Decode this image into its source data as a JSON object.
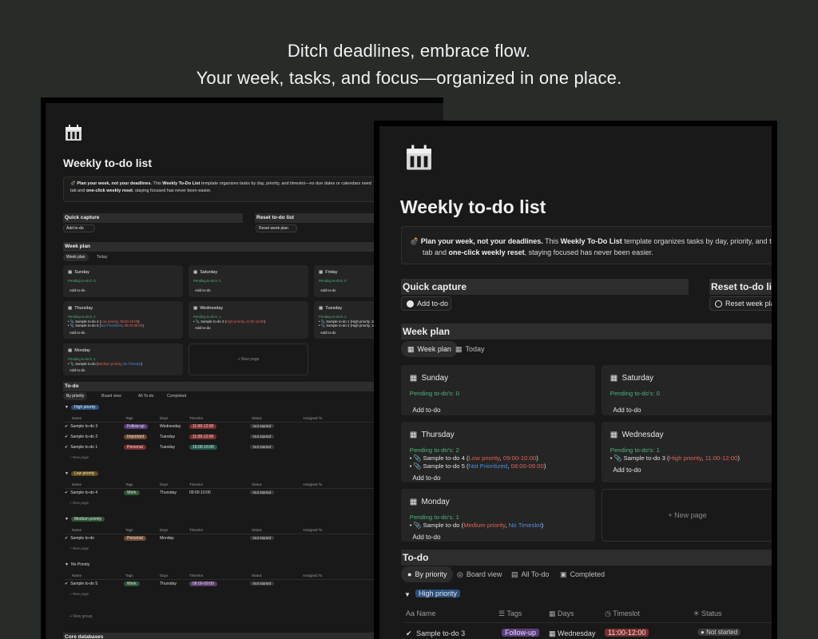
{
  "headline": {
    "line1": "Ditch deadlines, embrace flow.",
    "line2": "Your week, tasks, and focus—organized in one place."
  },
  "page": {
    "title": "Weekly to-do list",
    "callout": {
      "emoji": "💣",
      "bold1": "Plan your week, not your deadlines.",
      "t1": " This ",
      "bold2": "Weekly To-Do List",
      "t2_front": " template organizes tasks by day, priority, and ti",
      "t2_back": " template organizes tasks by day, priority, and timeslot—no due dates or calendars need",
      "line2_a": "tab and ",
      "line2_bold": "one-click weekly reset",
      "line2_b": ", staying focused has never been easier."
    },
    "quick_capture": "Quick capture",
    "add_todo": "Add to-do",
    "reset_front": "Reset to-do list",
    "reset_back": "Reset to-do list",
    "reset_week_front": "Reset week plan",
    "reset_week_back": "Reset week plan",
    "week_plan": "Week plan",
    "tab_week_plan": "Week plan",
    "tab_today": "Today",
    "new_page": "+ New page",
    "todo": "To-do",
    "tab_by_priority": "By priority",
    "tab_board_view": "Board view",
    "tab_all_todo": "All To-do",
    "tab_completed": "Completed",
    "core_databases": "Core databases",
    "new_group": "+ New group"
  },
  "days": [
    {
      "name": "Sunday",
      "pending": "Pending to-do's: 0",
      "add": "Add to-do",
      "items": []
    },
    {
      "name": "Saturday",
      "pending": "Pending to-do's: 0",
      "add": "Add to-do",
      "items": []
    },
    {
      "name": "Friday",
      "pending": "Pending to-do's: 0",
      "add": "Add to-do",
      "items": []
    },
    {
      "name": "Thursday",
      "pending": "Pending to-do's: 2",
      "add": "Add to-do",
      "items": [
        {
          "text": "Sample to-do 4",
          "meta_a": "Low priority",
          "meta_b": "09:00-10:00",
          "color_a": "red",
          "color_b": "red"
        },
        {
          "text": "Sample to-do 5",
          "meta_a": "Not Prioritized",
          "meta_b": "08:00-09:00",
          "color_a": "blue",
          "color_b": "red"
        }
      ]
    },
    {
      "name": "Wednesday",
      "pending": "Pending to-do's: 1",
      "add": "Add to-do",
      "items": [
        {
          "text": "Sample to-do 3",
          "meta_a": "High priority",
          "meta_b": "11:00-12:00",
          "color_a": "red",
          "color_b": "red"
        }
      ]
    },
    {
      "name": "Tuesday",
      "pending": "Pending to-do's: 2",
      "add": "Add to-do",
      "items": [
        {
          "text": "Sample to-do 1",
          "meta_a": "High priority",
          "meta_b": "15:00-16:00"
        },
        {
          "text": "Sample to-do 2",
          "meta_a": "High priority",
          "meta_b": "11:00-12:00"
        }
      ]
    },
    {
      "name": "Monday",
      "pending": "Pending to-do's: 1",
      "add": "Add to-do",
      "items": [
        {
          "text": "Sample to-do",
          "meta_a": "Medium priority",
          "meta_b": "No Timeslot",
          "color_a": "red",
          "color_b": "blue"
        }
      ]
    }
  ],
  "table": {
    "columns": [
      "Name",
      "Tags",
      "Days",
      "Timeslot",
      "Status",
      "Assigned To"
    ],
    "new_page": "+ New page",
    "groups": [
      {
        "label": "High priority",
        "color": "blue",
        "rows": [
          {
            "name": "Sample to-do 3",
            "tag": "Follow-up",
            "tag_color": "purple",
            "day": "Wednesday",
            "slot": "11:00-12:00",
            "slot_color": "red",
            "status": "Not started"
          },
          {
            "name": "Sample to-do 2",
            "tag": "Important",
            "tag_color": "brown",
            "day": "Tuesday",
            "slot": "11:00-12:00",
            "slot_color": "red",
            "status": "Not started"
          },
          {
            "name": "Sample to-do 1",
            "tag": "Personal",
            "tag_color": "red",
            "day": "Tuesday",
            "slot": "15:00-16:00",
            "slot_color": "teal",
            "status": "Not started"
          }
        ]
      },
      {
        "label": "Low priority",
        "color": "yellow",
        "rows": [
          {
            "name": "Sample to-do 4",
            "tag": "Work",
            "tag_color": "sgreen",
            "day": "Thursday",
            "slot": "09:00-10:00",
            "slot_color": "none",
            "status": "Not started"
          }
        ]
      },
      {
        "label": "Medium priority",
        "color": "sgreen",
        "rows": [
          {
            "name": "Sample to-do",
            "tag": "Personal",
            "tag_color": "brown",
            "day": "Monday",
            "slot": "",
            "slot_color": "none",
            "status": "Not started"
          }
        ]
      },
      {
        "label": "No Priority",
        "color": "none",
        "rows": [
          {
            "name": "Sample to-do 5",
            "tag": "Work",
            "tag_color": "sgreen",
            "day": "Thursday",
            "slot": "08:00-09:00",
            "slot_color": "mauve",
            "status": "Not started"
          }
        ]
      }
    ]
  },
  "front_table": {
    "group": "High priority",
    "columns": [
      "Name",
      "Tags",
      "Days",
      "Timeslot",
      "Status"
    ],
    "row": {
      "name": "Sample to-do 3",
      "tag": "Follow-up",
      "day": "Wednesday",
      "slot": "11:00-12:00",
      "status": "Not started"
    }
  },
  "colors": {
    "bg": "#282c28",
    "window": "#191919",
    "green_text": "#4fb57a",
    "red_text": "#e06456",
    "blue_text": "#4c8fe0"
  }
}
